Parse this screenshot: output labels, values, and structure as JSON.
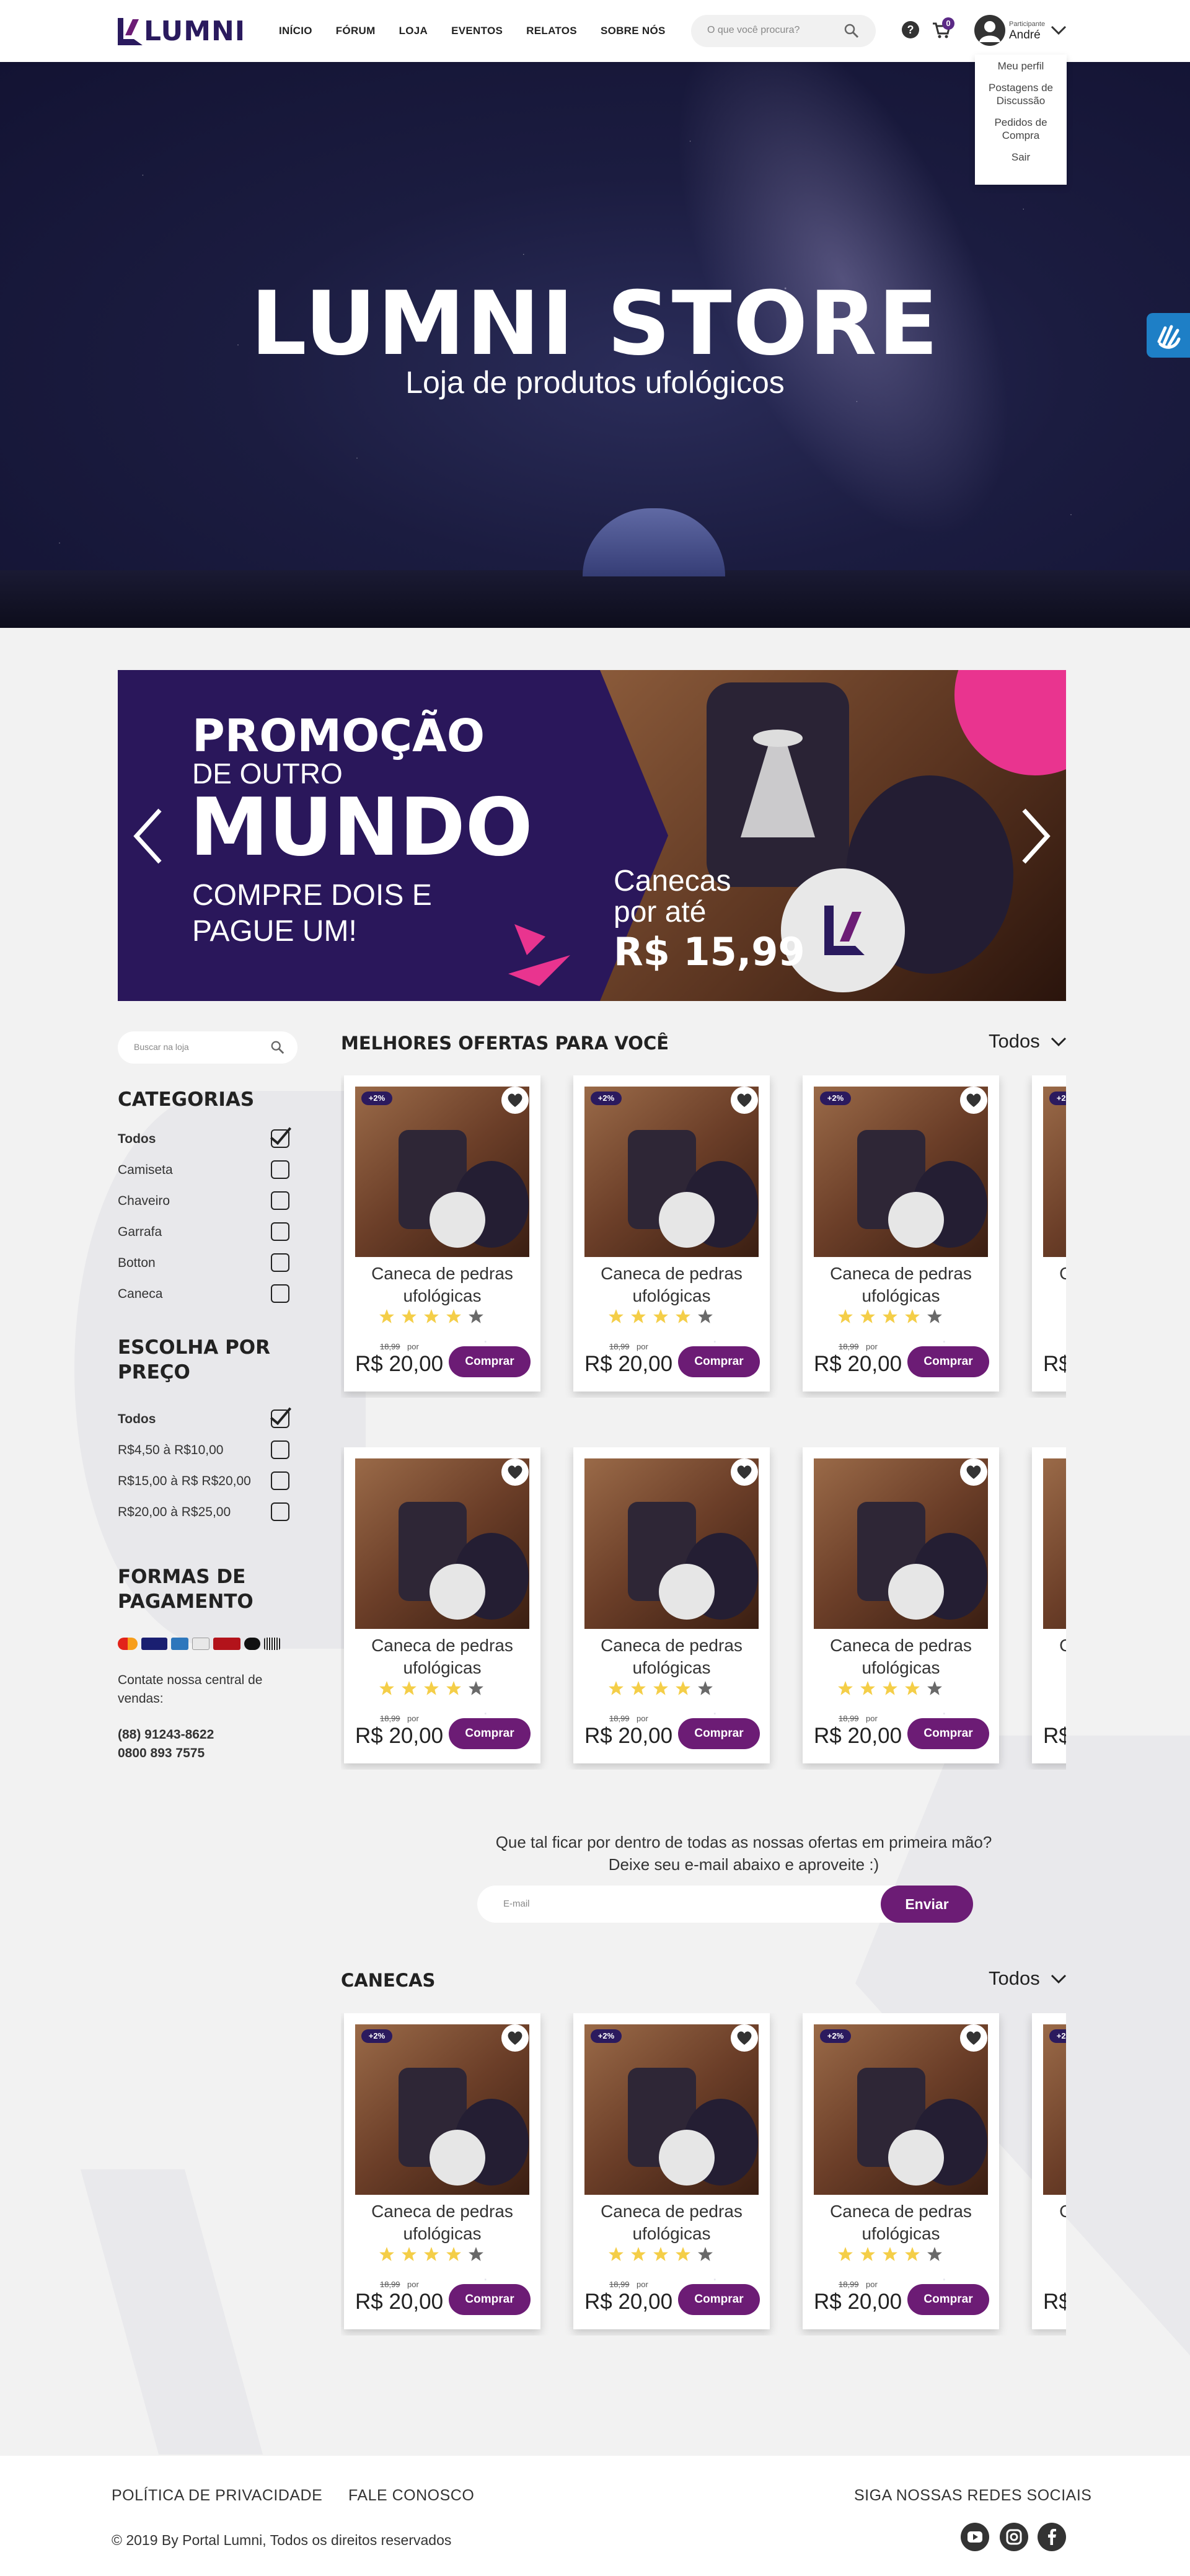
{
  "header": {
    "logo_text": "LUMNI",
    "nav": [
      "INÍCIO",
      "FÓRUM",
      "LOJA",
      "EVENTOS",
      "RELATOS",
      "SOBRE NÓS"
    ],
    "search_placeholder": "O que você procura?",
    "help_label": "?",
    "cart_count": "0",
    "user_role": "Participante",
    "user_name": "André",
    "menu": [
      "Meu perfil",
      "Postagens de Discussão",
      "Pedidos de Compra",
      "Sair"
    ]
  },
  "hero": {
    "title": "LUMNI STORE",
    "subtitle": "Loja de produtos ufológicos"
  },
  "promo": {
    "line1": "PROMOÇÃO",
    "line2": "DE OUTRO",
    "line3": "MUNDO",
    "line4": "COMPRE DOIS E PAGUE UM!",
    "mugs_text": "Canecas por até",
    "mugs_price": "R$ 15,99"
  },
  "sidebar": {
    "search_placeholder": "Buscar na loja",
    "categories_title": "CATEGORIAS",
    "categories": [
      {
        "label": "Todos",
        "checked": true
      },
      {
        "label": "Camiseta",
        "checked": false
      },
      {
        "label": "Chaveiro",
        "checked": false
      },
      {
        "label": "Garrafa",
        "checked": false
      },
      {
        "label": "Botton",
        "checked": false
      },
      {
        "label": "Caneca",
        "checked": false
      }
    ],
    "price_title": "ESCOLHA POR PREÇO",
    "prices": [
      {
        "label": "Todos",
        "checked": true
      },
      {
        "label": "R$4,50 à R$10,00",
        "checked": false
      },
      {
        "label": "R$15,00 à R$ R$20,00",
        "checked": false
      },
      {
        "label": "R$20,00 à R$25,00",
        "checked": false
      }
    ],
    "payment_title": "FORMAS DE PAGAMENTO",
    "payment_icons": [
      "mastercard-icon",
      "visa-icon",
      "amex-icon",
      "diners-icon",
      "hipercard-icon",
      "elo-icon",
      "boleto-icon"
    ],
    "contact_text": "Contate nossa central de vendas:",
    "phone1": "(88) 91243-8622",
    "phone2": "0800 893 7575"
  },
  "offers": {
    "title": "MELHORES OFERTAS PARA VOCÊ",
    "filter": "Todos"
  },
  "mugs_section": {
    "title": "CANECAS",
    "filter": "Todos"
  },
  "product": {
    "badge": "+2%",
    "name": "Caneca de pedras ufológicas",
    "rating": 4,
    "old_price": "18,99",
    "per": "por",
    "price": "R$ 20,00",
    "buy_label": "Comprar"
  },
  "newsletter": {
    "line1": "Que tal ficar por dentro de todas as nossas ofertas em primeira mão?",
    "line2": "Deixe seu e-mail abaixo e aproveite :)",
    "placeholder": "E-mail",
    "button": "Enviar"
  },
  "footer": {
    "privacy": "POLÍTICA DE PRIVACIDADE",
    "contact": "FALE CONOSCO",
    "social_title": "SIGA NOSSAS REDES SOCIAIS",
    "copyright": "© 2019 By Portal Lumni, Todos os direitos reservados",
    "social": [
      "youtube-icon",
      "instagram-icon",
      "facebook-icon"
    ]
  },
  "colors": {
    "brand": "#2a175b",
    "accent": "#6c1c75",
    "pink": "#e9348f",
    "star": "#f2c21b"
  }
}
